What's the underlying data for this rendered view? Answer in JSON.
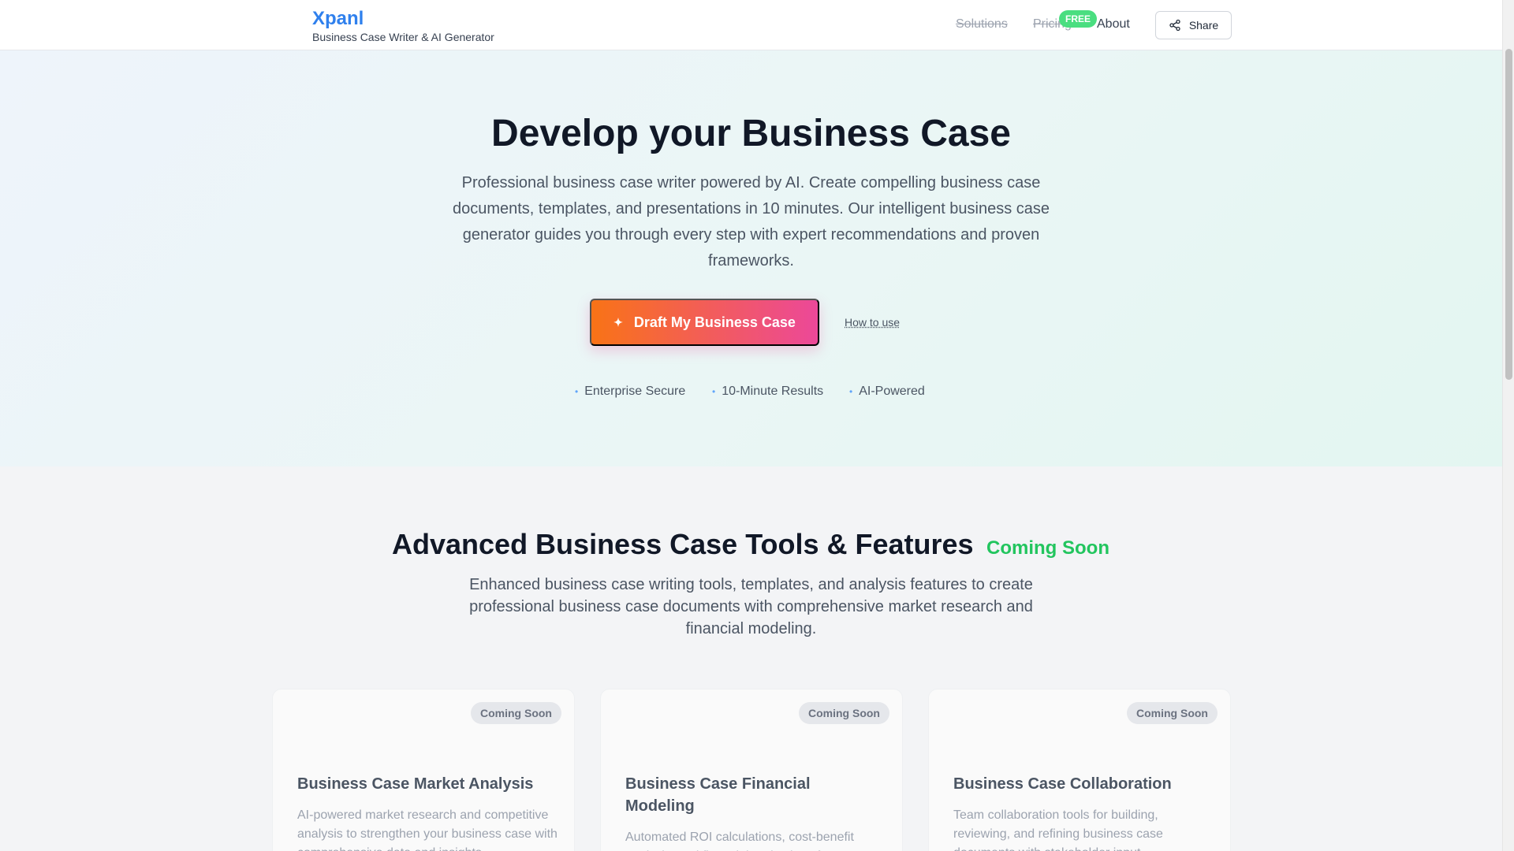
{
  "header": {
    "brand_name": "Xpanl",
    "brand_tagline": "Business Case Writer & AI Generator",
    "nav": {
      "solutions": "Solutions",
      "pricing": "Pricing",
      "pricing_badge": "FREE",
      "about": "About"
    },
    "share_label": "Share"
  },
  "hero": {
    "title": "Develop your Business Case",
    "subtitle": "Professional business case writer powered by AI. Create compelling business case documents, templates, and presentations in 10 minutes. Our intelligent business case generator guides you through every step with expert recommendations and proven frameworks.",
    "cta_label": "Draft My Business Case",
    "howto_label": "How to use",
    "features": [
      "Enterprise Secure",
      "10-Minute Results",
      "AI-Powered"
    ]
  },
  "tools": {
    "title": "Advanced Business Case Tools & Features",
    "coming_soon": "Coming Soon",
    "subtitle": "Enhanced business case writing tools, templates, and analysis features to create professional business case documents with comprehensive market research and financial modeling.",
    "cards": [
      {
        "badge": "Coming Soon",
        "title": "Business Case Market Analysis",
        "description": "AI-powered market research and competitive analysis to strengthen your business case with comprehensive data and insights."
      },
      {
        "badge": "Coming Soon",
        "title": "Business Case Financial Modeling",
        "description": "Automated ROI calculations, cost-benefit analysis, and financial projections for your business case."
      },
      {
        "badge": "Coming Soon",
        "title": "Business Case Collaboration",
        "description": "Team collaboration tools for building, reviewing, and refining business case documents with stakeholder input."
      }
    ]
  },
  "colors": {
    "brand": "#2f80ed",
    "cta_start": "#f97316",
    "cta_end": "#ec4899",
    "coming_soon": "#22c55e",
    "free_badge": "#4ade80"
  },
  "icons": {
    "share": "share-icon",
    "cta": "sparkle-icon",
    "feature_bullet": "dot-icon"
  }
}
